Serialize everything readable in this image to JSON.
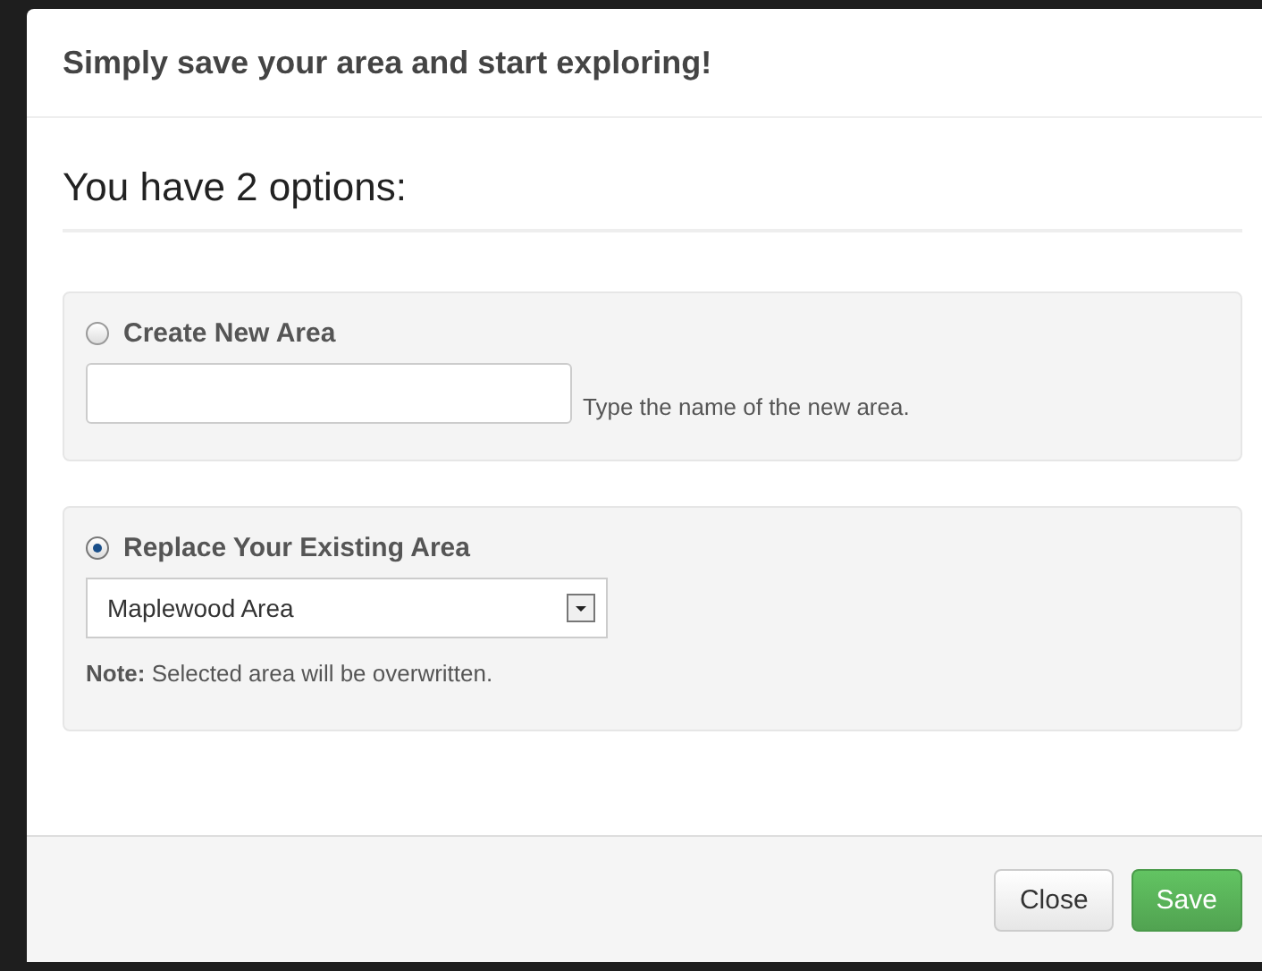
{
  "dialog": {
    "title": "Simply save your area and start exploring!"
  },
  "heading": "You have 2 options:",
  "options": [
    {
      "kind": "text",
      "label": "Create New Area",
      "selected": false,
      "hint": "Type the name of the new area."
    },
    {
      "kind": "select",
      "label": "Replace Your Existing Area",
      "selected": true,
      "value": "Maplewood Area",
      "note": "**Note:** Selected area will be overwritten."
    }
  ],
  "buttons": [
    {
      "label": "Close",
      "kind": "default"
    },
    {
      "label": "Save",
      "kind": "primary"
    }
  ]
}
